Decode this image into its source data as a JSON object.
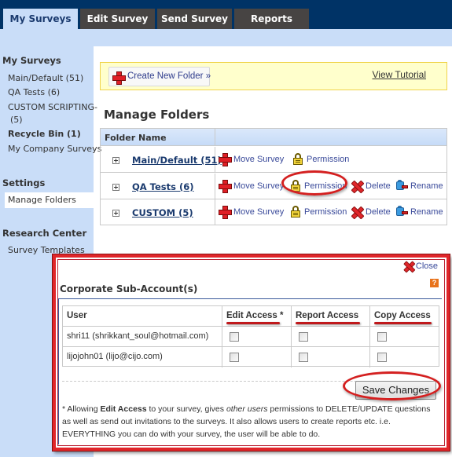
{
  "tabs": [
    {
      "label": "My Surveys",
      "active": true
    },
    {
      "label": "Edit Survey",
      "active": false
    },
    {
      "label": "Send Survey",
      "active": false
    },
    {
      "label": "Reports",
      "active": false
    }
  ],
  "sidebar": {
    "sections": [
      {
        "heading": "My Surveys",
        "items": [
          {
            "label": "Main/Default (51)"
          },
          {
            "label": "QA Tests (6)"
          },
          {
            "label": "CUSTOM SCRIPTING-"
          },
          {
            "label": "(5)"
          },
          {
            "label": "Recycle Bin (1)",
            "bold": true
          },
          {
            "label": "My Company Surveys"
          }
        ]
      },
      {
        "heading": "Settings",
        "items": [
          {
            "label": "Manage Folders",
            "selected": true
          }
        ]
      },
      {
        "heading": "Research Center",
        "items": [
          {
            "label": "Survey Templates"
          }
        ]
      }
    ]
  },
  "toolbar": {
    "create_folder_label": "Create New Folder »",
    "view_tutorial_label": "View Tutorial"
  },
  "manage_folders": {
    "title": "Manage Folders",
    "column_header": "Folder Name",
    "rows": [
      {
        "name": "Main/Default (51)",
        "actions": {
          "move": "Move Survey",
          "permission": "Permission"
        }
      },
      {
        "name": "QA Tests (6)",
        "actions": {
          "move": "Move Survey",
          "permission": "Permission",
          "delete": "Delete",
          "rename": "Rename"
        }
      },
      {
        "name": "CUSTOM (5)",
        "actions": {
          "move": "Move Survey",
          "permission": "Permission",
          "delete": "Delete",
          "rename": "Rename"
        }
      }
    ]
  },
  "modal": {
    "close_label": "Close",
    "help_label": "?",
    "title": "Corporate Sub-Account(s)",
    "columns": [
      "User",
      "Edit Access *",
      "Report Access",
      "Copy Access"
    ],
    "users": [
      {
        "user": "shri11 (shrikkant_soul@hotmail.com)",
        "edit": false,
        "report": false,
        "copy": false
      },
      {
        "user": "lijojohn01 (lijo@cijo.com)",
        "edit": false,
        "report": false,
        "copy": false
      }
    ],
    "save_label": "Save Changes",
    "note": {
      "prefix": "* Allowing ",
      "bold": "Edit Access",
      "mid": " to your survey, gives ",
      "italic": "other users",
      "rest": " permissions to DELETE/UPDATE questions as well as send out invitations to the surveys. It also allows users to create reports etc. i.e. EVERYTHING you can do with your survey, the user will be able to do."
    }
  },
  "colors": {
    "header_navy": "#003366",
    "tab_dark": "#474443",
    "light_blue": "#c9ddf8",
    "highlight_red": "#e0262a",
    "link_blue": "#3a4a9a"
  }
}
